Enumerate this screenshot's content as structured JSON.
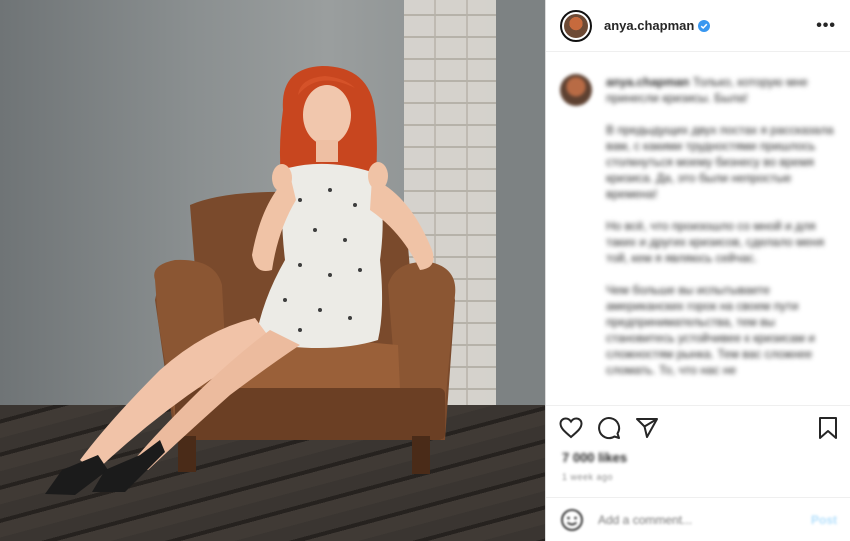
{
  "header": {
    "username": "anya.chapman",
    "verified": true,
    "more_label": "•••"
  },
  "caption": {
    "username": "anya.chapman",
    "paragraphs": [
      "Только, которую мне принесли кризисы. Была!",
      "В предыдущих двух постах я рассказала вам, с какими трудностями пришлось столкнуться моему бизнесу во время кризиса. Да, это были непростые времена!",
      "Но всё, что произошло со мной и для таких и других кризисов, сделало меня той, кем я являюсь сейчас.",
      "Чем больше вы испытываете американских горок на своем пути предпринимательства, тем вы становитесь устойчивее к кризисам и сложностям рынка. Тем вас сложнее сломать. То, что нас не"
    ]
  },
  "icons": {
    "like": "heart-icon",
    "comment": "comment-icon",
    "share": "share-icon",
    "save": "bookmark-icon",
    "emoji": "smiley-icon",
    "verified": "verified-badge-icon"
  },
  "likes_text": "7 000 likes",
  "timestamp": "1 week ago",
  "comment_box": {
    "placeholder": "Add a comment...",
    "post_label": "Post"
  },
  "colors": {
    "verified": "#3897f0",
    "post_button": "#b2dffc",
    "text": "#262626",
    "muted": "#8e8e8e"
  }
}
